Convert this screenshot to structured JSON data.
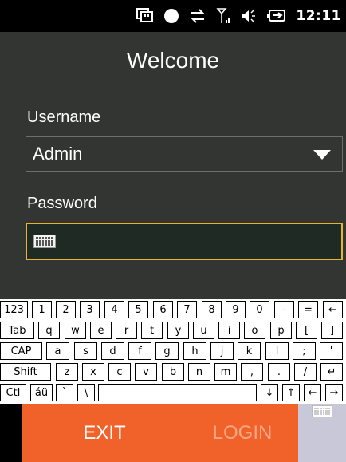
{
  "status_bar": {
    "icons": [
      "windows-icon",
      "bluetooth-dot-icon",
      "sync-arrows-icon",
      "signal-icon",
      "volume-icon",
      "battery-icon"
    ],
    "time": "12:11"
  },
  "screen": {
    "title": "Welcome",
    "username_label": "Username",
    "username_value": "Admin",
    "password_label": "Password",
    "password_value": ""
  },
  "keyboard": {
    "rows": [
      [
        "123",
        "1",
        "2",
        "3",
        "4",
        "5",
        "6",
        "7",
        "8",
        "9",
        "0",
        "-",
        "=",
        "←"
      ],
      [
        "Tab",
        "q",
        "w",
        "e",
        "r",
        "t",
        "y",
        "u",
        "i",
        "o",
        "p",
        "[",
        "]"
      ],
      [
        "CAP",
        "a",
        "s",
        "d",
        "f",
        "g",
        "h",
        "j",
        "k",
        "l",
        ";",
        "'"
      ],
      [
        "Shift",
        "z",
        "x",
        "c",
        "v",
        "b",
        "n",
        "m",
        ",",
        ".",
        "/",
        "↵"
      ],
      [
        "Ctl",
        "áü",
        "`",
        "\\",
        " ",
        "↓",
        "↑",
        "←",
        "→"
      ]
    ]
  },
  "buttons": {
    "exit": "EXIT",
    "login": "LOGIN"
  },
  "colors": {
    "accent_orange": "#f0622a",
    "focus_border": "#e7b42d",
    "background": "#333533"
  }
}
